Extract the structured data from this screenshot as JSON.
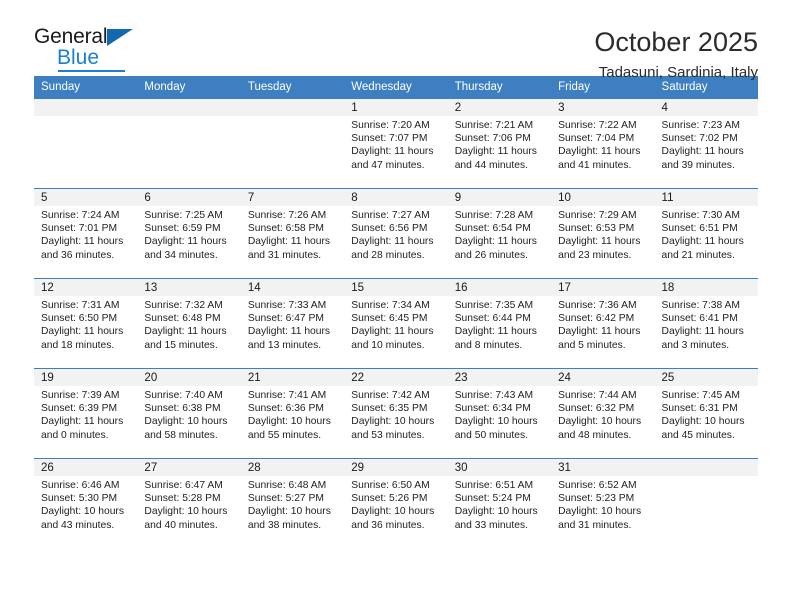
{
  "brand": {
    "name_part1": "General",
    "name_part2": "Blue",
    "triangle_color": "#1269b0",
    "blue_color": "#1b7fd4"
  },
  "header": {
    "title": "October 2025",
    "subtitle": "Tadasuni, Sardinia, Italy"
  },
  "theme": {
    "header_blue": "#3d7fc1",
    "daynum_band": "#f2f2f2"
  },
  "weekdays": [
    "Sunday",
    "Monday",
    "Tuesday",
    "Wednesday",
    "Thursday",
    "Friday",
    "Saturday"
  ],
  "weeks": [
    [
      {
        "day": "",
        "sunrise": "",
        "sunset": "",
        "daylight_line1": "",
        "daylight_line2": ""
      },
      {
        "day": "",
        "sunrise": "",
        "sunset": "",
        "daylight_line1": "",
        "daylight_line2": ""
      },
      {
        "day": "",
        "sunrise": "",
        "sunset": "",
        "daylight_line1": "",
        "daylight_line2": ""
      },
      {
        "day": "1",
        "sunrise": "Sunrise: 7:20 AM",
        "sunset": "Sunset: 7:07 PM",
        "daylight_line1": "Daylight: 11 hours",
        "daylight_line2": "and 47 minutes."
      },
      {
        "day": "2",
        "sunrise": "Sunrise: 7:21 AM",
        "sunset": "Sunset: 7:06 PM",
        "daylight_line1": "Daylight: 11 hours",
        "daylight_line2": "and 44 minutes."
      },
      {
        "day": "3",
        "sunrise": "Sunrise: 7:22 AM",
        "sunset": "Sunset: 7:04 PM",
        "daylight_line1": "Daylight: 11 hours",
        "daylight_line2": "and 41 minutes."
      },
      {
        "day": "4",
        "sunrise": "Sunrise: 7:23 AM",
        "sunset": "Sunset: 7:02 PM",
        "daylight_line1": "Daylight: 11 hours",
        "daylight_line2": "and 39 minutes."
      }
    ],
    [
      {
        "day": "5",
        "sunrise": "Sunrise: 7:24 AM",
        "sunset": "Sunset: 7:01 PM",
        "daylight_line1": "Daylight: 11 hours",
        "daylight_line2": "and 36 minutes."
      },
      {
        "day": "6",
        "sunrise": "Sunrise: 7:25 AM",
        "sunset": "Sunset: 6:59 PM",
        "daylight_line1": "Daylight: 11 hours",
        "daylight_line2": "and 34 minutes."
      },
      {
        "day": "7",
        "sunrise": "Sunrise: 7:26 AM",
        "sunset": "Sunset: 6:58 PM",
        "daylight_line1": "Daylight: 11 hours",
        "daylight_line2": "and 31 minutes."
      },
      {
        "day": "8",
        "sunrise": "Sunrise: 7:27 AM",
        "sunset": "Sunset: 6:56 PM",
        "daylight_line1": "Daylight: 11 hours",
        "daylight_line2": "and 28 minutes."
      },
      {
        "day": "9",
        "sunrise": "Sunrise: 7:28 AM",
        "sunset": "Sunset: 6:54 PM",
        "daylight_line1": "Daylight: 11 hours",
        "daylight_line2": "and 26 minutes."
      },
      {
        "day": "10",
        "sunrise": "Sunrise: 7:29 AM",
        "sunset": "Sunset: 6:53 PM",
        "daylight_line1": "Daylight: 11 hours",
        "daylight_line2": "and 23 minutes."
      },
      {
        "day": "11",
        "sunrise": "Sunrise: 7:30 AM",
        "sunset": "Sunset: 6:51 PM",
        "daylight_line1": "Daylight: 11 hours",
        "daylight_line2": "and 21 minutes."
      }
    ],
    [
      {
        "day": "12",
        "sunrise": "Sunrise: 7:31 AM",
        "sunset": "Sunset: 6:50 PM",
        "daylight_line1": "Daylight: 11 hours",
        "daylight_line2": "and 18 minutes."
      },
      {
        "day": "13",
        "sunrise": "Sunrise: 7:32 AM",
        "sunset": "Sunset: 6:48 PM",
        "daylight_line1": "Daylight: 11 hours",
        "daylight_line2": "and 15 minutes."
      },
      {
        "day": "14",
        "sunrise": "Sunrise: 7:33 AM",
        "sunset": "Sunset: 6:47 PM",
        "daylight_line1": "Daylight: 11 hours",
        "daylight_line2": "and 13 minutes."
      },
      {
        "day": "15",
        "sunrise": "Sunrise: 7:34 AM",
        "sunset": "Sunset: 6:45 PM",
        "daylight_line1": "Daylight: 11 hours",
        "daylight_line2": "and 10 minutes."
      },
      {
        "day": "16",
        "sunrise": "Sunrise: 7:35 AM",
        "sunset": "Sunset: 6:44 PM",
        "daylight_line1": "Daylight: 11 hours",
        "daylight_line2": "and 8 minutes."
      },
      {
        "day": "17",
        "sunrise": "Sunrise: 7:36 AM",
        "sunset": "Sunset: 6:42 PM",
        "daylight_line1": "Daylight: 11 hours",
        "daylight_line2": "and 5 minutes."
      },
      {
        "day": "18",
        "sunrise": "Sunrise: 7:38 AM",
        "sunset": "Sunset: 6:41 PM",
        "daylight_line1": "Daylight: 11 hours",
        "daylight_line2": "and 3 minutes."
      }
    ],
    [
      {
        "day": "19",
        "sunrise": "Sunrise: 7:39 AM",
        "sunset": "Sunset: 6:39 PM",
        "daylight_line1": "Daylight: 11 hours",
        "daylight_line2": "and 0 minutes."
      },
      {
        "day": "20",
        "sunrise": "Sunrise: 7:40 AM",
        "sunset": "Sunset: 6:38 PM",
        "daylight_line1": "Daylight: 10 hours",
        "daylight_line2": "and 58 minutes."
      },
      {
        "day": "21",
        "sunrise": "Sunrise: 7:41 AM",
        "sunset": "Sunset: 6:36 PM",
        "daylight_line1": "Daylight: 10 hours",
        "daylight_line2": "and 55 minutes."
      },
      {
        "day": "22",
        "sunrise": "Sunrise: 7:42 AM",
        "sunset": "Sunset: 6:35 PM",
        "daylight_line1": "Daylight: 10 hours",
        "daylight_line2": "and 53 minutes."
      },
      {
        "day": "23",
        "sunrise": "Sunrise: 7:43 AM",
        "sunset": "Sunset: 6:34 PM",
        "daylight_line1": "Daylight: 10 hours",
        "daylight_line2": "and 50 minutes."
      },
      {
        "day": "24",
        "sunrise": "Sunrise: 7:44 AM",
        "sunset": "Sunset: 6:32 PM",
        "daylight_line1": "Daylight: 10 hours",
        "daylight_line2": "and 48 minutes."
      },
      {
        "day": "25",
        "sunrise": "Sunrise: 7:45 AM",
        "sunset": "Sunset: 6:31 PM",
        "daylight_line1": "Daylight: 10 hours",
        "daylight_line2": "and 45 minutes."
      }
    ],
    [
      {
        "day": "26",
        "sunrise": "Sunrise: 6:46 AM",
        "sunset": "Sunset: 5:30 PM",
        "daylight_line1": "Daylight: 10 hours",
        "daylight_line2": "and 43 minutes."
      },
      {
        "day": "27",
        "sunrise": "Sunrise: 6:47 AM",
        "sunset": "Sunset: 5:28 PM",
        "daylight_line1": "Daylight: 10 hours",
        "daylight_line2": "and 40 minutes."
      },
      {
        "day": "28",
        "sunrise": "Sunrise: 6:48 AM",
        "sunset": "Sunset: 5:27 PM",
        "daylight_line1": "Daylight: 10 hours",
        "daylight_line2": "and 38 minutes."
      },
      {
        "day": "29",
        "sunrise": "Sunrise: 6:50 AM",
        "sunset": "Sunset: 5:26 PM",
        "daylight_line1": "Daylight: 10 hours",
        "daylight_line2": "and 36 minutes."
      },
      {
        "day": "30",
        "sunrise": "Sunrise: 6:51 AM",
        "sunset": "Sunset: 5:24 PM",
        "daylight_line1": "Daylight: 10 hours",
        "daylight_line2": "and 33 minutes."
      },
      {
        "day": "31",
        "sunrise": "Sunrise: 6:52 AM",
        "sunset": "Sunset: 5:23 PM",
        "daylight_line1": "Daylight: 10 hours",
        "daylight_line2": "and 31 minutes."
      },
      {
        "day": "",
        "sunrise": "",
        "sunset": "",
        "daylight_line1": "",
        "daylight_line2": ""
      }
    ]
  ]
}
